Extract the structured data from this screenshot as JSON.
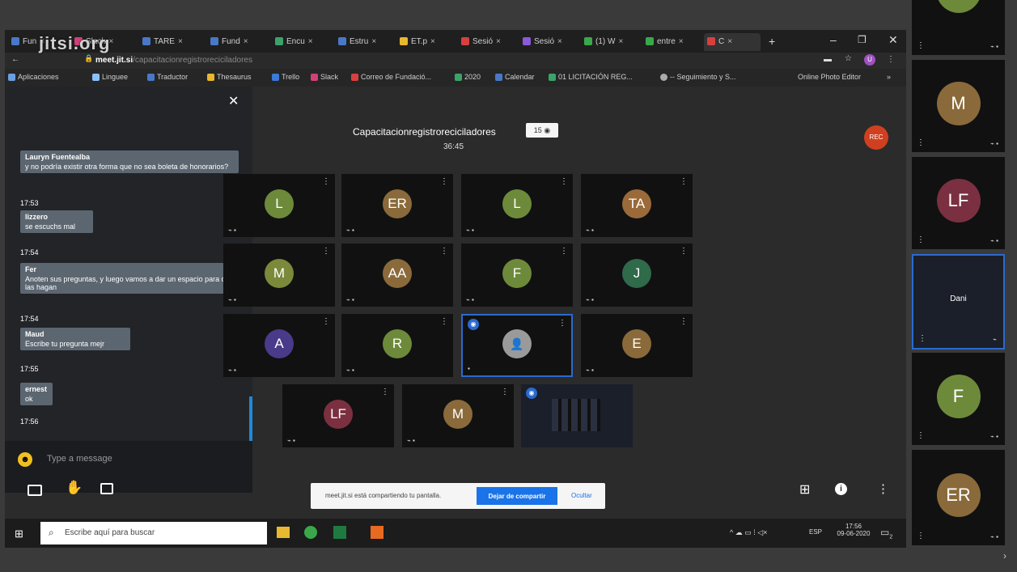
{
  "browser": {
    "tabs": [
      {
        "label": "Fun",
        "color": "#4a78c8"
      },
      {
        "label": "Slack",
        "color": "#d0407a"
      },
      {
        "label": "TARE",
        "color": "#4a78c8"
      },
      {
        "label": "Fund",
        "color": "#4a78c8"
      },
      {
        "label": "Encu",
        "color": "#3ba36a"
      },
      {
        "label": "Estru",
        "color": "#4a78c8"
      },
      {
        "label": "ET.p",
        "color": "#e8b830"
      },
      {
        "label": "Sesió",
        "color": "#d84040"
      },
      {
        "label": "Sesió",
        "color": "#8a5ad8"
      },
      {
        "label": "(1) W",
        "color": "#3aa84a"
      },
      {
        "label": "entre",
        "color": "#3aa84a"
      },
      {
        "label": "C",
        "color": "#d84040"
      }
    ],
    "new_tab": "+",
    "url_domain": "meet.jit.si",
    "url_path": "/capacitacionregistroreciciladores",
    "bookmarks": [
      "Aplicaciones",
      "Linguee",
      "Traductor",
      "Thesaurus",
      "Trello",
      "Slack",
      "Correo de Fundació...",
      "2020",
      "Calendar",
      "01 LICITACIÓN REG...",
      "-- Seguimiento y S...",
      "Online Photo Editor"
    ],
    "profile_initial": "U"
  },
  "logo_text": "jitsi.org",
  "meeting": {
    "title": "Capacitacionregistroreciciladores",
    "participants": "15",
    "timer": "36:45",
    "rec_label": "REC"
  },
  "chat": {
    "messages": [
      {
        "sender": "Lauryn Fuentealba",
        "text": "y no podría existir otra forma que no sea boleta de honorarios?",
        "time": "17:53"
      },
      {
        "sender": "lizzero",
        "text": "se escuchs mal",
        "time": "17:54"
      },
      {
        "sender": "Fer",
        "text": "Anoten sus preguntas, y luego vamos a dar un espacio para que las hagan",
        "time": "17:54"
      },
      {
        "sender": "Maud",
        "text": "Escribe tu pregunta mejr",
        "time": "17:55"
      },
      {
        "sender": "ernest",
        "text": "ok",
        "time": "17:56"
      }
    ],
    "placeholder": "Type a message"
  },
  "tiles": [
    {
      "initials": "L",
      "color": "#6d8a3a"
    },
    {
      "initials": "ER",
      "color": "#8a6a3a"
    },
    {
      "initials": "L",
      "color": "#6d8a3a"
    },
    {
      "initials": "TA",
      "color": "#9a6a3a"
    },
    {
      "initials": "M",
      "color": "#7a8a3a"
    },
    {
      "initials": "AA",
      "color": "#8a6a3a"
    },
    {
      "initials": "F",
      "color": "#6d8a3a"
    },
    {
      "initials": "J",
      "color": "#2f6a4a"
    },
    {
      "initials": "A",
      "color": "#4a3a8a"
    },
    {
      "initials": "R",
      "color": "#6d8a3a"
    },
    {
      "initials": "",
      "color": "#9a9a9a"
    },
    {
      "initials": "E",
      "color": "#8a6a3a"
    },
    {
      "initials": "LF",
      "color": "#7a3040"
    },
    {
      "initials": "M",
      "color": "#8a6a3a"
    }
  ],
  "filmstrip": [
    {
      "initials": "M",
      "color": "#8a6a3a"
    },
    {
      "initials": "LF",
      "color": "#7a3040"
    },
    {
      "name": "Dani"
    },
    {
      "initials": "F",
      "color": "#6d8a3a"
    },
    {
      "initials": "ER",
      "color": "#8a6a3a"
    }
  ],
  "share_bar": {
    "text": "meet.jit.si está compartiendo tu pantalla.",
    "stop_label": "Dejar de compartir",
    "hide_label": "Ocultar"
  },
  "taskbar": {
    "search_placeholder": "Escribe aquí para buscar",
    "lang": "ESP",
    "time": "17:56",
    "date": "09-06-2020",
    "notif_count": "2"
  }
}
